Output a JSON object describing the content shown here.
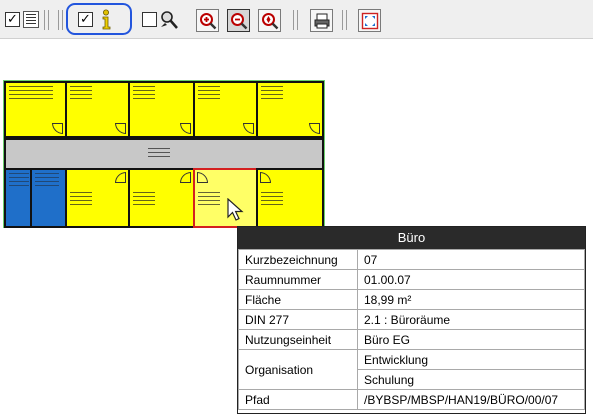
{
  "toolbar": {
    "items": [
      {
        "type": "checkbox",
        "checked": true,
        "icon": "legend-list-icon"
      },
      {
        "type": "checkbox",
        "checked": true,
        "icon": "info-icon"
      },
      {
        "type": "checkbox",
        "checked": false,
        "icon": "pick-tool-icon"
      },
      {
        "type": "button",
        "icon": "zoom-in-icon"
      },
      {
        "type": "button",
        "icon": "zoom-out-icon",
        "active": true
      },
      {
        "type": "button",
        "icon": "zoom-extent-icon"
      },
      {
        "type": "button",
        "icon": "print-icon"
      },
      {
        "type": "button",
        "icon": "fit-screen-icon"
      }
    ],
    "highlight_color": "#2255dd"
  },
  "floorplan": {
    "room_color": "#ffff00",
    "corridor_color": "#c8c8c8",
    "office_blue": "#1f6fc9",
    "selected_border": "#d42020"
  },
  "popup": {
    "title": "Büro",
    "rows": [
      {
        "key": "Kurzbezeichnung",
        "value": "07"
      },
      {
        "key": "Raumnummer",
        "value": "01.00.07"
      },
      {
        "key": "Fläche",
        "value": "18,99 m²"
      },
      {
        "key": "DIN 277",
        "value": "2.1 : Büroräume"
      },
      {
        "key": "Nutzungseinheit",
        "value": "Büro EG"
      }
    ],
    "organisation": {
      "key": "Organisation",
      "values": [
        "Entwicklung",
        "Schulung"
      ]
    },
    "path": {
      "key": "Pfad",
      "value": "/BYBSP/MBSP/HAN19/BÜRO/00/07"
    }
  }
}
